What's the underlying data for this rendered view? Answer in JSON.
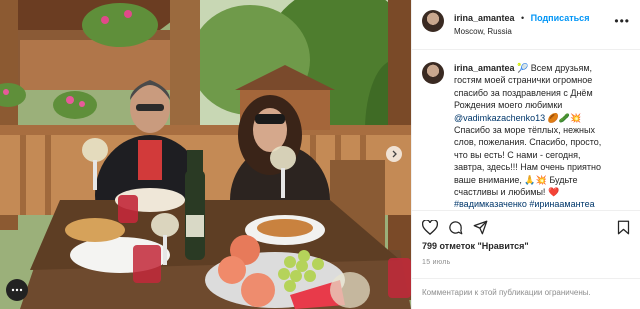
{
  "post": {
    "username": "irina_amantea",
    "follow_label": "Подписаться",
    "separator": "•",
    "location": "Moscow, Russia",
    "caption": {
      "username": "irina_amantea",
      "line1": "Всем друзьям,",
      "line2": "гостям моей странички огромное",
      "line3": "спасибо за поздравления с Днём",
      "line4": "Рождения моего любимки",
      "mention": "@vadimkazachenko13",
      "line5": "Спасибо за море тёплых, нежных",
      "line6": "слов, пожелания. Спасибо, просто,",
      "line7": "что вы есть! С нами - сегодня,",
      "line8": "завтра, здесь!!! Нам очень приятно",
      "line9": "ваше внимание,",
      "line9b": "Будьте",
      "line10": "счастливы и любимы!",
      "tags": "#вадимказаченко #иринаамантеа"
    },
    "likes": "799 отметок \"Нравится\"",
    "date": "15 июль",
    "comments_notice": "Комментарии к этой публикации ограничены."
  },
  "icons": [
    "heart-icon",
    "comment-icon",
    "share-icon",
    "bookmark-icon",
    "more-icon",
    "chevron-right-icon"
  ],
  "colors": {
    "follow": "#0095f6",
    "mention": "#00376b",
    "muted": "#8e8e8e",
    "text": "#262626"
  }
}
